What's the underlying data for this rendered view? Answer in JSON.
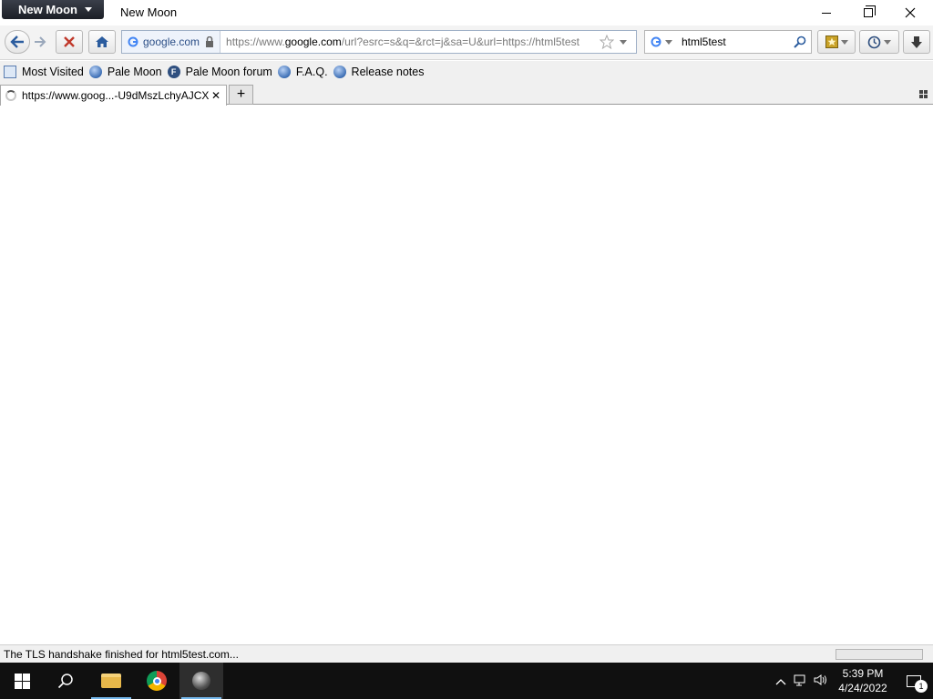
{
  "window": {
    "app_menu_label": "New Moon",
    "title": "New Moon"
  },
  "navbar": {
    "identity_label": "google.com",
    "url_host_prefix": "https://www.",
    "url_host": "google.com",
    "url_rest": "/url?esrc=s&q=&rct=j&sa=U&url=https://html5test",
    "search_value": "html5test"
  },
  "bookmarks": [
    {
      "label": "Most Visited",
      "icon": "most-visited-icon"
    },
    {
      "label": "Pale Moon",
      "icon": "globe-icon"
    },
    {
      "label": "Pale Moon forum",
      "icon": "forum-icon"
    },
    {
      "label": "F.A.Q.",
      "icon": "globe-icon"
    },
    {
      "label": "Release notes",
      "icon": "globe-icon"
    }
  ],
  "tabs": [
    {
      "label": "https://www.goog...-U9dMszLchyAJCX",
      "loading": true
    }
  ],
  "status": {
    "text": "The TLS handshake finished for html5test.com..."
  },
  "taskbar": {
    "time": "5:39 PM",
    "date": "4/24/2022",
    "notification_count": "1"
  },
  "colors": {
    "taskbar": "#101010",
    "app_menu": "#1c1f26",
    "identity_text": "#2c4f87"
  }
}
